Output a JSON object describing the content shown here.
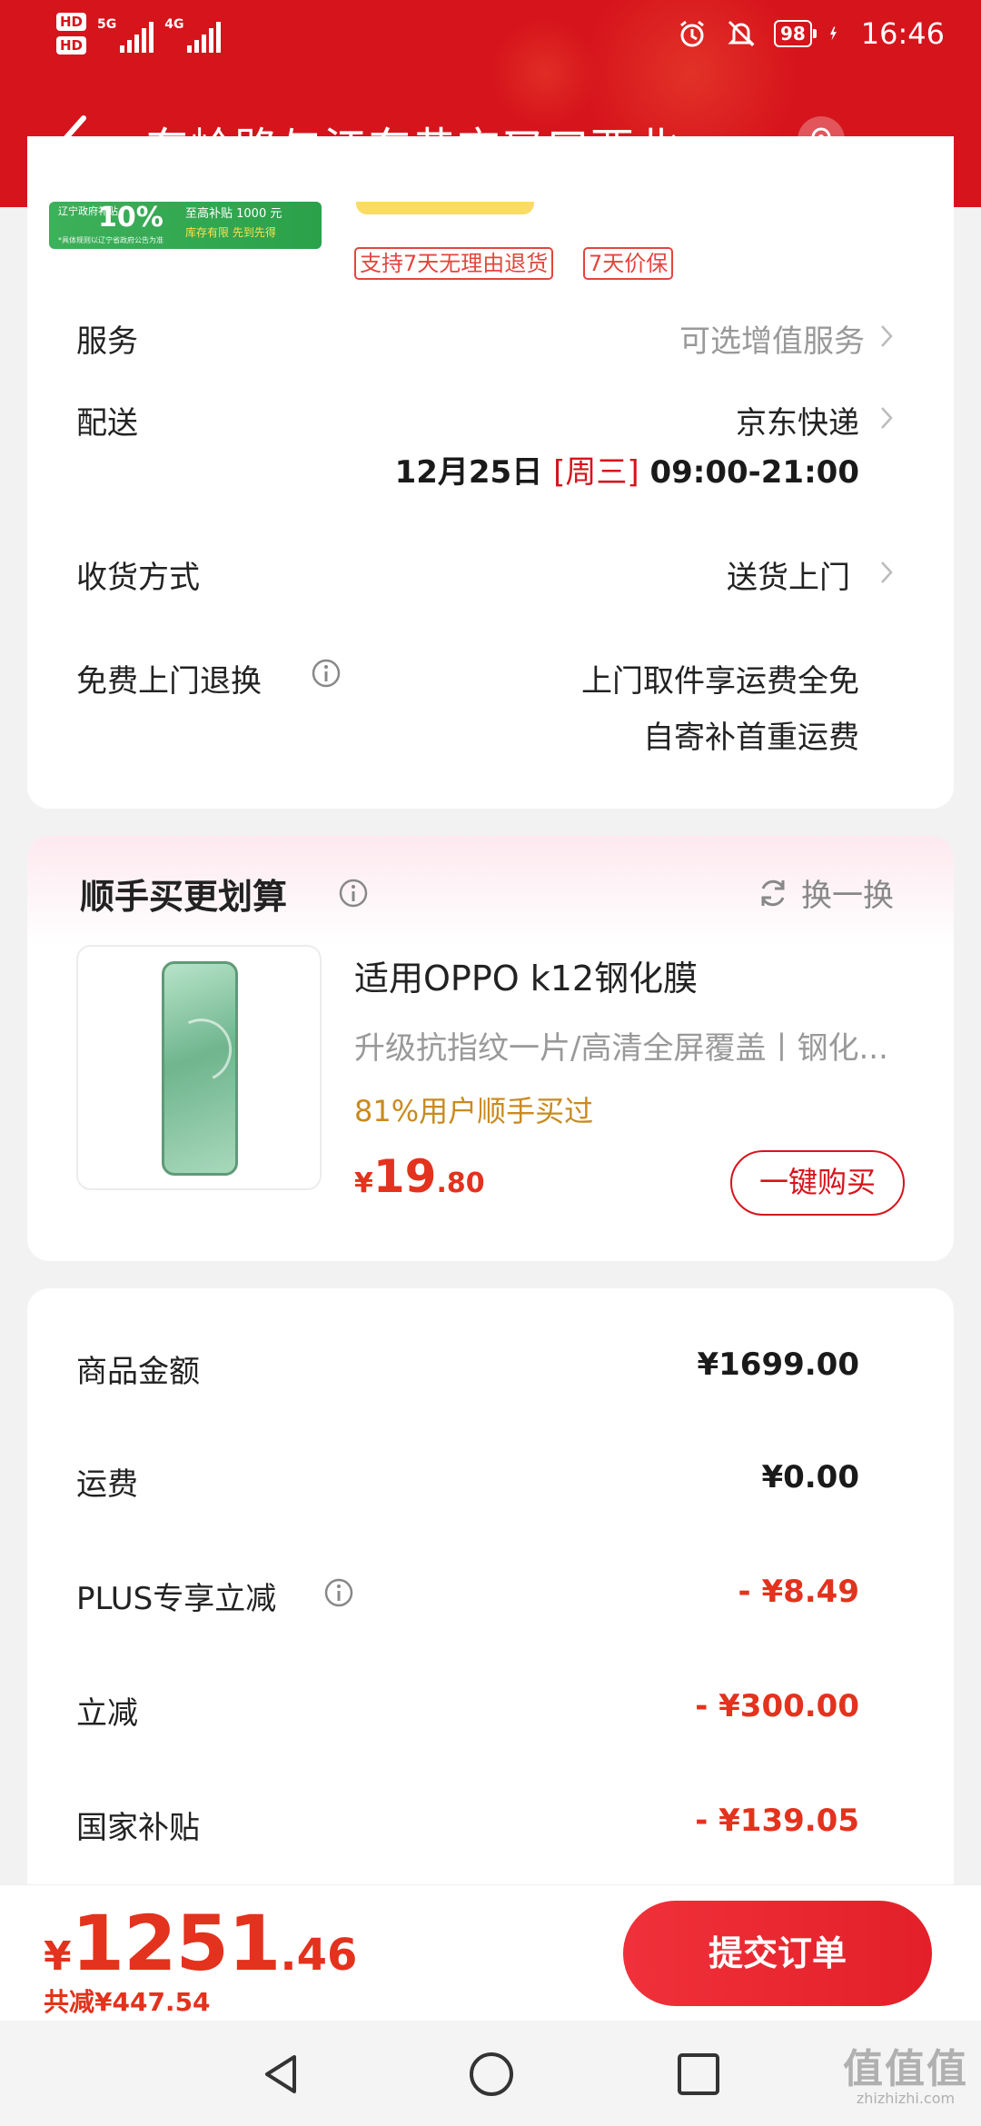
{
  "status_bar": {
    "hd1": "HD",
    "hd2": "HD",
    "net1": "5G",
    "net2": "4G",
    "battery": "98",
    "time": "16:46"
  },
  "header": {
    "title": "东岭路与江东巷交叉口西北..."
  },
  "promo": {
    "line1": "辽宁政府补贴",
    "pct": "10%",
    "line2": "至高补贴 1000 元",
    "line3": "库存有限 先到先得",
    "small": "*具体规则以辽宁省政府公告为准"
  },
  "tags": [
    "支持7天无理由退货",
    "7天价保"
  ],
  "info_rows": {
    "service": {
      "label": "服务",
      "value": "可选增值服务"
    },
    "delivery": {
      "label": "配送",
      "value": "京东快递",
      "date": "12月25日",
      "weekday": "[周三]",
      "time": "09:00-21:00"
    },
    "receive": {
      "label": "收货方式",
      "value": "送货上门"
    },
    "free_return": {
      "label": "免费上门退换",
      "value1": "上门取件享运费全免",
      "value2": "自寄补首重运费"
    }
  },
  "addon": {
    "title": "顺手买更划算",
    "swap": "换一换",
    "product_title": "适用OPPO k12钢化膜",
    "product_sub": "升级抗指纹一片/高清全屏覆盖丨钢化...",
    "percent_text": "81%用户顺手买过",
    "price_cur": "¥",
    "price_int": "19",
    "price_dec": ".80",
    "buy_label": "一键购买"
  },
  "summary": {
    "rows": [
      {
        "label": "商品金额",
        "value": "¥1699.00"
      },
      {
        "label": "运费",
        "value": "¥0.00"
      },
      {
        "label": "PLUS专享立减",
        "value": "- ¥8.49"
      },
      {
        "label": "立减",
        "value": "- ¥300.00"
      },
      {
        "label": "国家补贴",
        "value": "- ¥139.05"
      }
    ]
  },
  "bottom": {
    "cur": "¥",
    "int": "1251",
    "dec": ".46",
    "saved": "共减¥447.54",
    "submit": "提交订单"
  },
  "watermark": {
    "main": "值值值",
    "url": "zhizhizhi.com"
  },
  "colors": {
    "brand_red": "#d6141c",
    "price_red": "#e3321d",
    "accent_gold": "#c98a1e"
  }
}
